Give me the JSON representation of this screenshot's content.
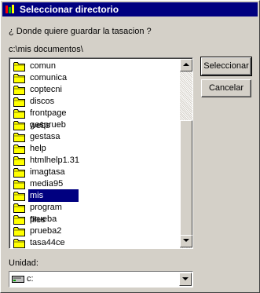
{
  "window": {
    "title": "Seleccionar directorio",
    "app_icon": "app-logo-icon"
  },
  "prompt": "¿ Donde quiere guardar la tasacion ?",
  "current_path": "c:\\mis documentos\\",
  "folders": [
    {
      "label": "comun",
      "selected": false
    },
    {
      "label": "comunica",
      "selected": false
    },
    {
      "label": "coptecni",
      "selected": false
    },
    {
      "label": "discos",
      "selected": false
    },
    {
      "label": "frontpage webs",
      "selected": false
    },
    {
      "label": "gesprueb",
      "selected": false
    },
    {
      "label": "gestasa",
      "selected": false
    },
    {
      "label": "help",
      "selected": false
    },
    {
      "label": "htmlhelp1.31",
      "selected": false
    },
    {
      "label": "imagtasa",
      "selected": false
    },
    {
      "label": "media95",
      "selected": false
    },
    {
      "label": "mis documentos",
      "selected": true
    },
    {
      "label": "program files",
      "selected": false
    },
    {
      "label": "prueba",
      "selected": false
    },
    {
      "label": "prueba2",
      "selected": false
    },
    {
      "label": "tasa44ce",
      "selected": false
    }
  ],
  "buttons": {
    "select_label": "Seleccionar",
    "cancel_label": "Cancelar"
  },
  "drive": {
    "label": "Unidad:",
    "value": "c:",
    "icon": "drive-icon"
  },
  "colors": {
    "titlebar": "#000080",
    "selection": "#000080",
    "face": "#d4d0c8",
    "folder": "#ffff00"
  }
}
